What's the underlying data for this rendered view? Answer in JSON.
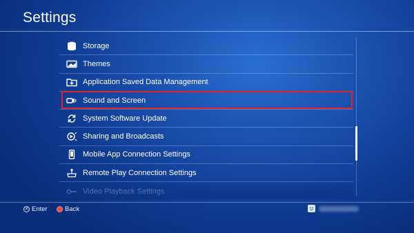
{
  "header": {
    "title": "Settings"
  },
  "menu": {
    "items": [
      {
        "label": "Storage",
        "icon": "storage-icon"
      },
      {
        "label": "Themes",
        "icon": "themes-icon"
      },
      {
        "label": "Application Saved Data Management",
        "icon": "saved-data-icon"
      },
      {
        "label": "Sound and Screen",
        "icon": "sound-screen-icon",
        "selected": true
      },
      {
        "label": "System Software Update",
        "icon": "update-icon"
      },
      {
        "label": "Sharing and Broadcasts",
        "icon": "sharing-icon"
      },
      {
        "label": "Mobile App Connection Settings",
        "icon": "mobile-icon"
      },
      {
        "label": "Remote Play Connection Settings",
        "icon": "remote-play-icon"
      },
      {
        "label": "Video Playback Settings",
        "icon": "video-playback-icon"
      }
    ]
  },
  "footer": {
    "enter_label": "Enter",
    "back_label": "Back",
    "enter_glyph": "✕",
    "back_glyph": "○"
  },
  "colors": {
    "background": "#1a4fae",
    "highlight_border": "#e02424",
    "text": "#ffffff"
  }
}
